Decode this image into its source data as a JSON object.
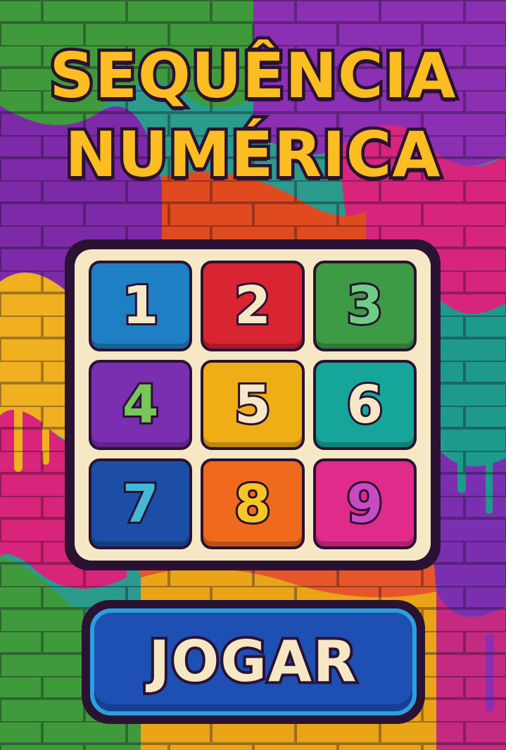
{
  "title": {
    "line1": "SEQUÊNCIA",
    "line2": "NUMÉRICA"
  },
  "grid": {
    "tiles": [
      {
        "number": "1",
        "tile_color": "#1f7fc4",
        "number_color": "#f6e8c5"
      },
      {
        "number": "2",
        "tile_color": "#d92532",
        "number_color": "#f6e8c5"
      },
      {
        "number": "3",
        "tile_color": "#3d9a45",
        "number_color": "#6fce86"
      },
      {
        "number": "4",
        "tile_color": "#7a2fb0",
        "number_color": "#78c65a"
      },
      {
        "number": "5",
        "tile_color": "#f0ae16",
        "number_color": "#f6e8c5"
      },
      {
        "number": "6",
        "tile_color": "#16a59a",
        "number_color": "#f6e8c5"
      },
      {
        "number": "7",
        "tile_color": "#1c4ea6",
        "number_color": "#43b9d8"
      },
      {
        "number": "8",
        "tile_color": "#ef6a1c",
        "number_color": "#f7c52a"
      },
      {
        "number": "9",
        "tile_color": "#e02b8a",
        "number_color": "#c94bc4"
      }
    ]
  },
  "play_button": {
    "label": "JOGAR"
  },
  "colors": {
    "title": "#fbbd22",
    "outline": "#2a1233",
    "board_bg": "#f6e8c5",
    "button": "#1e4fb3",
    "button_rim": "#2c9fe0"
  }
}
